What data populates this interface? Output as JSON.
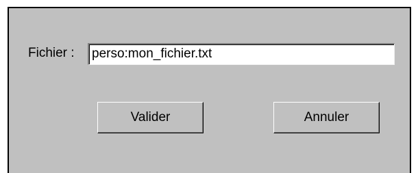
{
  "dialog": {
    "file_label": "Fichier :",
    "file_value": "perso:mon_fichier.txt",
    "validate_label": "Valider",
    "cancel_label": "Annuler"
  },
  "colors": {
    "dialog_background": "#c0c0c0",
    "field_background": "#ffffff",
    "text": "#000000"
  }
}
